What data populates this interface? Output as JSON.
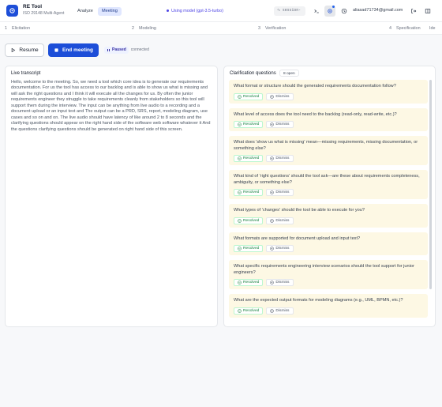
{
  "app": {
    "name": "RE Tool",
    "subtitle": "ISO 29148 Multi-Agent",
    "nav_tabs": [
      {
        "label": "Analyze",
        "active": false
      },
      {
        "label": "Meeting",
        "active": true
      }
    ],
    "model_label": "Using model (gpt-3.5-turbo)",
    "session_label": "session-",
    "user_email": "aliasad71734@gmail.com",
    "icons": [
      "terminal-icon",
      "settings-icon",
      "history-icon",
      "logout-icon",
      "split-view-icon"
    ]
  },
  "steps": [
    {
      "num": "1",
      "label": "Elicitation"
    },
    {
      "num": "2",
      "label": "Modeling"
    },
    {
      "num": "3",
      "label": "Verification"
    },
    {
      "num": "4",
      "label": "Specification"
    }
  ],
  "steps_extra": "Ide",
  "controls": {
    "resume_label": "Resume",
    "end_label": "End meeting",
    "status_label": "Paused",
    "connection_label": "connected"
  },
  "transcript": {
    "title": "Live transcript",
    "text": "Hello, welcome to the meeting. So, we need a tool which core idea is to generate our requirements documentation. For us the tool has access to our backlog and is able to show us what is missing and will ask the right questions and I think it will execute all the changes for us. By often the junior requirements engineer they struggle to take requirements cleanly from stakeholders so this tool will support them during the interview. The input can be anything from live audio to a recording and a document upload or an input text and The output can be a PRD, SRS, report, modeling diagram, use cases and so on and on. The live audio should have latency of like around 2 to 8 seconds and the clarifying questions should appear on the right hand side of the software web software whatever it And the questions clarifying questions should be generated on right hand side of this screen."
  },
  "questions": {
    "title": "Clarification questions",
    "count_label": "8 open",
    "resolved_label": "Resolved",
    "dismiss_label": "Dismiss",
    "items": [
      "What format or structure should the generated requirements documentation follow?",
      "What level of access does the tool need to the backlog (read-only, read-write, etc.)?",
      "What does 'show us what is missing' mean—missing requirements, missing documentation, or something else?",
      "What kind of 'right questions' should the tool ask—are these about requirements completeness, ambiguity, or something else?",
      "What types of 'changes' should the tool be able to execute for you?",
      "What formats are supported for document upload and input text?",
      "What specific requirements engineering interview scenarios should the tool support for junior engineers?",
      "What are the expected output formats for modeling diagrams (e.g., UML, BPMN, etc.)?"
    ]
  },
  "colors": {
    "accent": "#1d4ed8",
    "card_bg": "#fdf8e4",
    "resolved": "#15803d"
  }
}
